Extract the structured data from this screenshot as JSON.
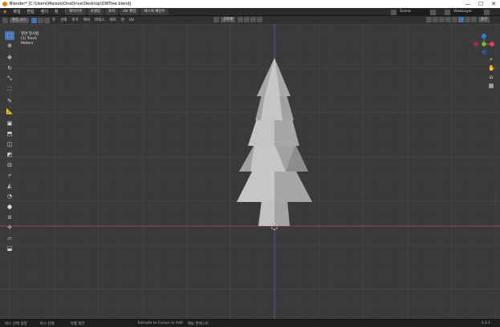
{
  "window": {
    "title": "Blender* [C:\\Users\\Maisoo\\OneDrive\\Desktop\\DWTree.blend]",
    "minimize": "—",
    "maximize": "☐",
    "close": "✕"
  },
  "menubar": {
    "items": [
      "파일",
      "편집",
      "렌더",
      "창",
      "도움말"
    ],
    "tabs": [
      "레이아웃",
      "모델링",
      "조각",
      "UV 편집",
      "텍스처 페인트"
    ],
    "scene_label": "Scene",
    "view_layer_label": "ViewLayer"
  },
  "header": {
    "mode_label": "편집 모드",
    "menus": [
      "뷰",
      "선택",
      "추가",
      "메쉬",
      "버텍스",
      "에지",
      "면",
      "UV"
    ],
    "transform_label": "글로벌",
    "options_label": "옵션"
  },
  "overlay": {
    "view_name": "정면 정사법",
    "object_name": "(1) Tree1",
    "units": "Meters"
  },
  "toolbar": {
    "tools": [
      {
        "name": "select-box-tool",
        "glyph": "⬚",
        "selected": true
      },
      {
        "name": "cursor-tool",
        "glyph": "⊕",
        "selected": false
      },
      {
        "name": "move-tool",
        "glyph": "✥",
        "selected": false
      },
      {
        "name": "rotate-tool",
        "glyph": "↻",
        "selected": false
      },
      {
        "name": "scale-tool",
        "glyph": "⤡",
        "selected": false
      },
      {
        "name": "transform-tool",
        "glyph": "⛶",
        "selected": false
      },
      {
        "name": "annotate-tool",
        "glyph": "✎",
        "selected": false
      },
      {
        "name": "measure-tool",
        "glyph": "📐",
        "selected": false
      },
      {
        "name": "add-cube-tool",
        "glyph": "▣",
        "selected": false
      },
      {
        "name": "extrude-tool",
        "glyph": "⬒",
        "selected": false
      },
      {
        "name": "inset-tool",
        "glyph": "◫",
        "selected": false
      },
      {
        "name": "bevel-tool",
        "glyph": "◩",
        "selected": false
      },
      {
        "name": "loop-cut-tool",
        "glyph": "⊟",
        "selected": false
      },
      {
        "name": "knife-tool",
        "glyph": "⌿",
        "selected": false
      },
      {
        "name": "poly-build-tool",
        "glyph": "◭",
        "selected": false
      },
      {
        "name": "spin-tool",
        "glyph": "◔",
        "selected": false
      },
      {
        "name": "smooth-tool",
        "glyph": "●",
        "selected": false
      },
      {
        "name": "edge-slide-tool",
        "glyph": "⧄",
        "selected": false
      },
      {
        "name": "shrink-fatten-tool",
        "glyph": "✢",
        "selected": false
      },
      {
        "name": "shear-tool",
        "glyph": "▱",
        "selected": false
      },
      {
        "name": "rip-region-tool",
        "glyph": "⬓",
        "selected": false
      }
    ]
  },
  "nav": {
    "icons": [
      "zoom-icon",
      "hand-pan-icon",
      "camera-icon",
      "grid-perspective-icon"
    ]
  },
  "gizmo": {
    "x_color": "#e0404f",
    "y_color": "#6fbd2a",
    "z_color": "#2e7fd8"
  },
  "statusbar": {
    "left": [
      "박스 선택 설정",
      "박스 선택",
      "뷰를 회전"
    ],
    "middle": "Extrude to Cursor or Add",
    "middle2": "메뉴 컨텍스트",
    "version": "3.3.1"
  },
  "colors": {
    "x_axis_line": "#b8434d",
    "z_axis_line": "#3f6fa3",
    "selected_tool": "#4772b3",
    "tree_light": "#c2c2c2",
    "tree_mid": "#a7a7a7",
    "tree_dark": "#8d8d8d"
  }
}
